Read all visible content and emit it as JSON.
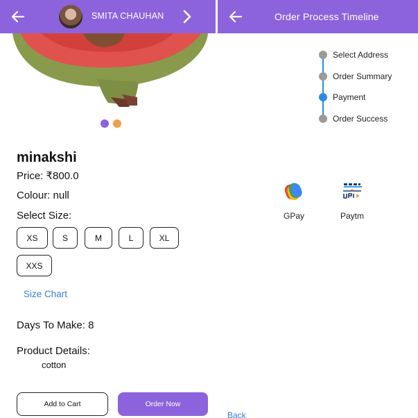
{
  "left_panel": {
    "header": {
      "title": "SMITA CHAUHAN",
      "back_icon": "arrow-left-icon",
      "next_icon": "chevron-right-icon",
      "color": "#8c63dc"
    },
    "carousel": {
      "indicator_colors": [
        "#8c63dc",
        "#f0a04b"
      ]
    },
    "product": {
      "name": "minakshi",
      "price": "Price: ₹800.0",
      "colour": "Colour: null",
      "select_size_label": "Select Size:",
      "sizes": [
        "XS",
        "S",
        "M",
        "L",
        "XL",
        "XXS"
      ],
      "size_chart_link": "Size Chart",
      "days_to_make": "Days To Make: 8",
      "details_label": "Product Details:",
      "details_value": "cotton"
    },
    "actions": {
      "add_to_cart": "Add to Cart",
      "order_now": "Order Now"
    }
  },
  "right_panel": {
    "header": {
      "title": "Order Process Timeline",
      "back_icon": "arrow-left-icon"
    },
    "timeline": [
      {
        "label": "Select Address",
        "active": false
      },
      {
        "label": "Order Summary",
        "active": false
      },
      {
        "label": "Payment",
        "active": true
      },
      {
        "label": "Order Success",
        "active": false
      }
    ],
    "payment_options": [
      {
        "label": "GPay",
        "icon": "gpay-icon"
      },
      {
        "label": "Paytm",
        "icon": "paytm-upi-icon"
      }
    ],
    "back_link": "Back"
  }
}
